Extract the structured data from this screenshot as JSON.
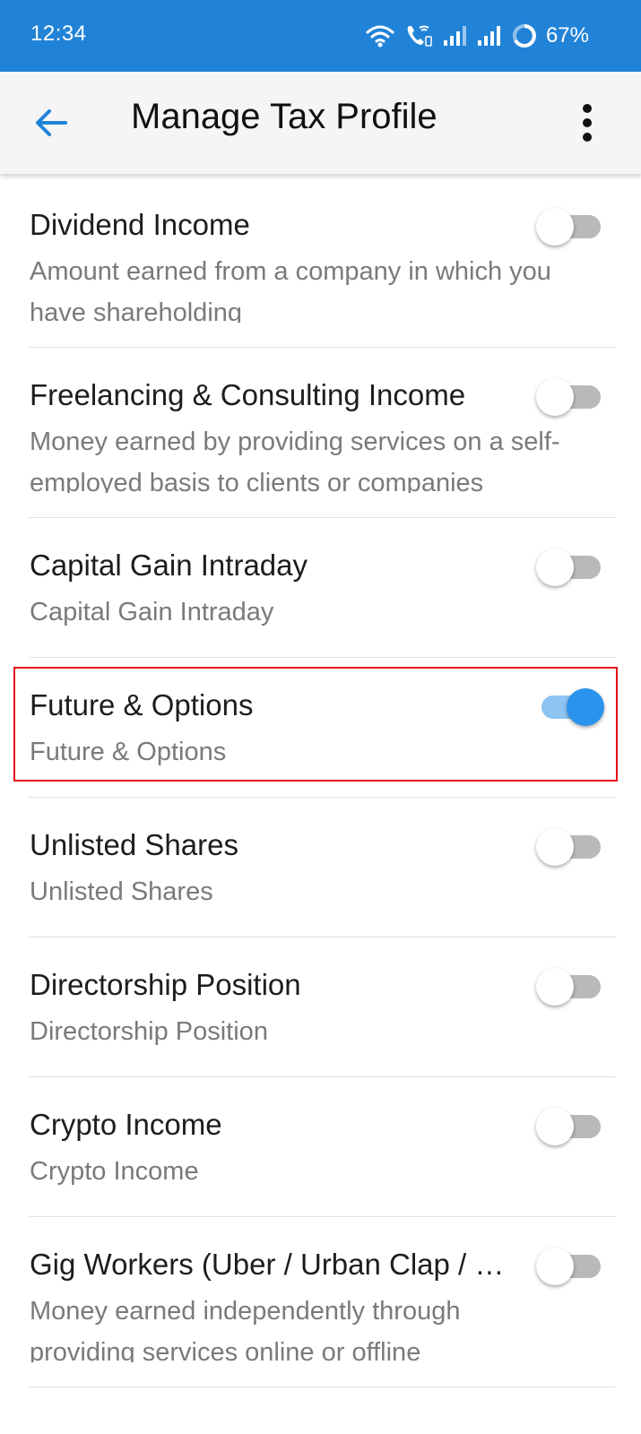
{
  "status_bar": {
    "time": "12:34",
    "battery": "67%",
    "icons": [
      "wifi-icon",
      "wifi-calling-icon",
      "signal-icon",
      "signal-icon",
      "battery-ring-icon"
    ]
  },
  "app_bar": {
    "title": "Manage Tax Profile",
    "back_icon": "arrow-back-icon",
    "menu_icon": "more-vert-icon",
    "accent": "#2183d7"
  },
  "items": [
    {
      "title": "Dividend Income",
      "description": "Amount earned from a company in which you have shareholding",
      "enabled": false
    },
    {
      "title": "Freelancing & Consulting Income",
      "description": "Money earned by providing services on a self-employed basis to clients or companies",
      "enabled": false
    },
    {
      "title": "Capital Gain Intraday",
      "description": "Capital Gain Intraday",
      "enabled": false
    },
    {
      "title": "Future & Options",
      "description": "Future & Options",
      "enabled": true
    },
    {
      "title": "Unlisted Shares",
      "description": "Unlisted Shares",
      "enabled": false
    },
    {
      "title": "Directorship Position",
      "description": "Directorship Position",
      "enabled": false
    },
    {
      "title": "Crypto Income",
      "description": "Crypto Income",
      "enabled": false
    },
    {
      "title": "Gig Workers (Uber / Urban Clap / Zomato)",
      "description": "Money earned independently through providing services online or offline",
      "enabled": false
    }
  ],
  "colors": {
    "toggle_on_thumb": "#2a93ee",
    "toggle_on_track": "#8cc4f2",
    "toggle_off_track": "#b9b9b9",
    "highlight": "#e8101a"
  }
}
